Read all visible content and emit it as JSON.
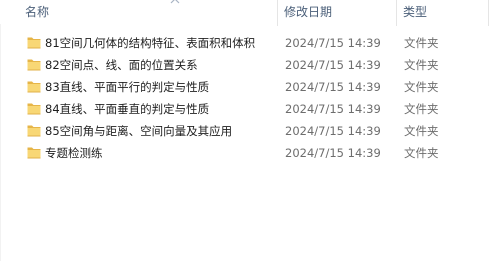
{
  "columns": {
    "name": "名称",
    "date": "修改日期",
    "type": "类型"
  },
  "files": [
    {
      "name": "81空间几何体的结构特征、表面积和体积",
      "date": "2024/7/15 14:39",
      "type": "文件夹"
    },
    {
      "name": "82空间点、线、面的位置关系",
      "date": "2024/7/15 14:39",
      "type": "文件夹"
    },
    {
      "name": "83直线、平面平行的判定与性质",
      "date": "2024/7/15 14:39",
      "type": "文件夹"
    },
    {
      "name": "84直线、平面垂直的判定与性质",
      "date": "2024/7/15 14:39",
      "type": "文件夹"
    },
    {
      "name": "85空间角与距离、空间向量及其应用",
      "date": "2024/7/15 14:39",
      "type": "文件夹"
    },
    {
      "name": "专题检测练",
      "date": "2024/7/15 14:39",
      "type": "文件夹"
    }
  ],
  "icons": {
    "folder": "folder-icon",
    "sort": "sort-up-arrow-icon"
  },
  "colors": {
    "folder_body": "#f8d775",
    "folder_tab": "#e6b548",
    "header_text": "#4c607a",
    "secondary_text": "#6d6d6d"
  }
}
